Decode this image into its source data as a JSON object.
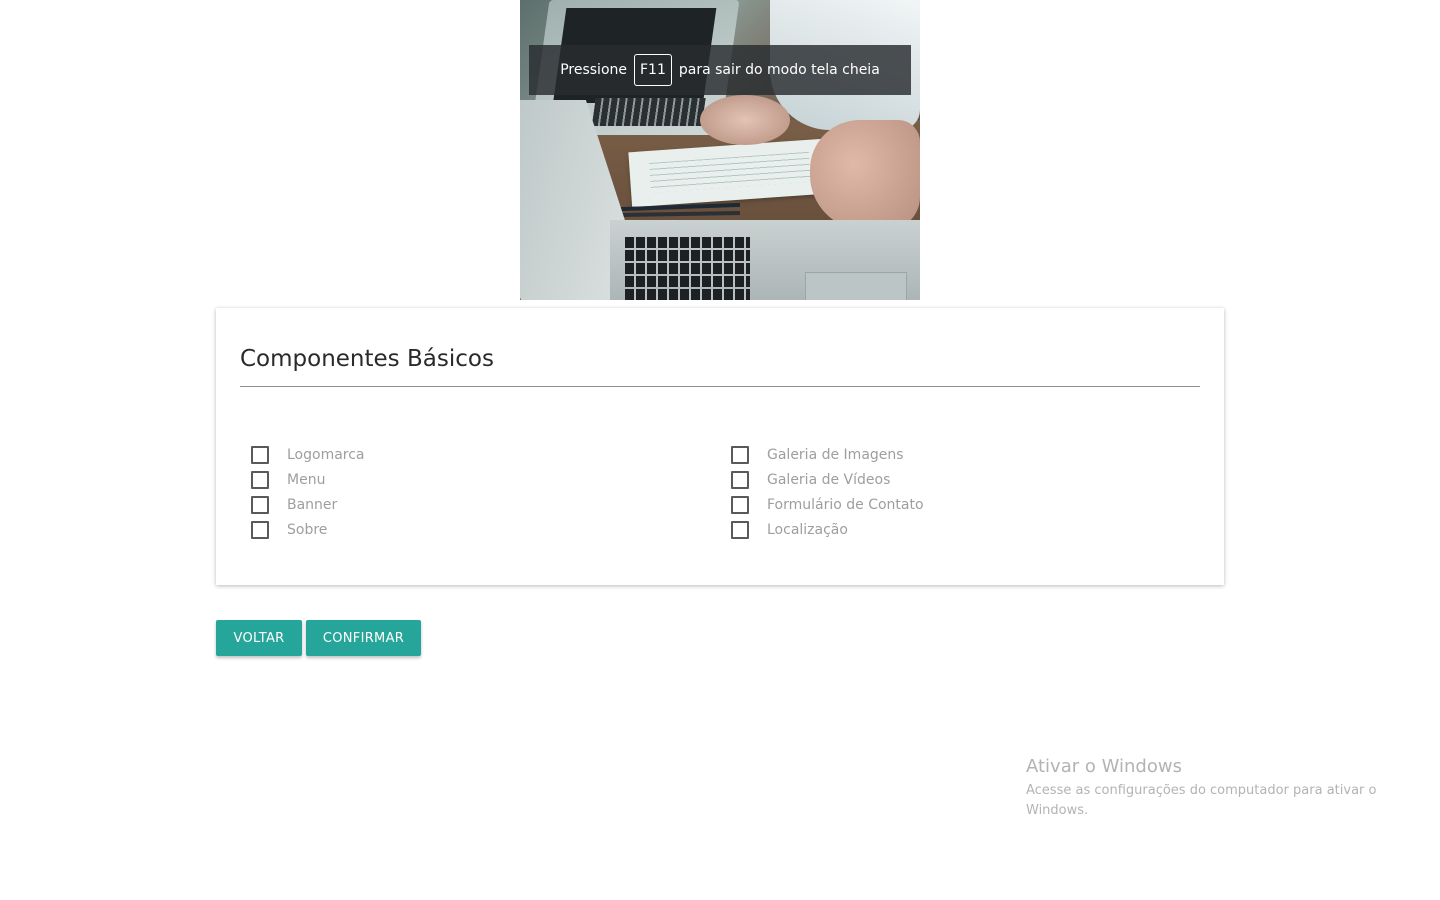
{
  "fullscreen_notice": {
    "prefix": "Pressione",
    "key": "F11",
    "suffix": "para sair do modo tela cheia"
  },
  "section": {
    "title": "Componentes Básicos",
    "left_options": [
      {
        "label": "Logomarca",
        "checked": false
      },
      {
        "label": "Menu",
        "checked": false
      },
      {
        "label": "Banner",
        "checked": false
      },
      {
        "label": "Sobre",
        "checked": false
      }
    ],
    "right_options": [
      {
        "label": "Galeria de Imagens",
        "checked": false
      },
      {
        "label": "Galeria de Vídeos",
        "checked": false
      },
      {
        "label": "Formulário de Contato",
        "checked": false
      },
      {
        "label": "Localização",
        "checked": false
      }
    ]
  },
  "actions": {
    "back_label": "VOLTAR",
    "confirm_label": "CONFIRMAR"
  },
  "windows_activation": {
    "title": "Ativar o Windows",
    "subtitle": "Acesse as configurações do computador para ativar o Windows."
  },
  "colors": {
    "accent": "#26a69a",
    "label": "#9e9e9e"
  }
}
